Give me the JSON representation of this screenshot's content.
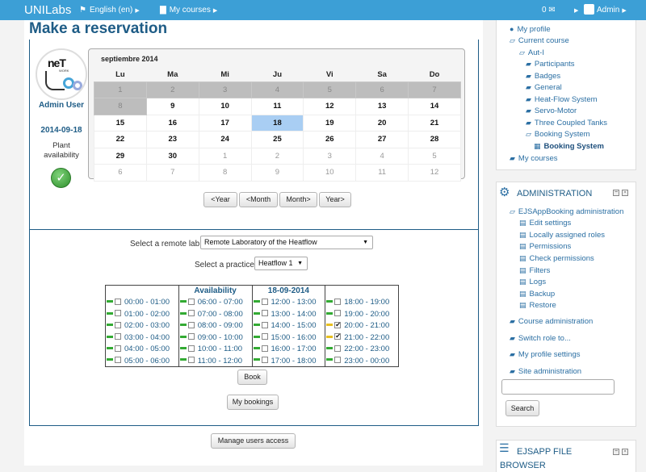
{
  "navbar": {
    "brand": "UNILabs",
    "language": "English (en)",
    "courses": "My courses",
    "messages": "0",
    "user": "Admin"
  },
  "page": {
    "title": "Make a reservation",
    "user_name": "Admin User",
    "date": "2014-09-18",
    "plant_availability": "Plant availability"
  },
  "calendar": {
    "month": "septiembre 2014",
    "weekdays": [
      "Lu",
      "Ma",
      "Mi",
      "Ju",
      "Vi",
      "Sa",
      "Do"
    ],
    "weeks": [
      [
        "1",
        "2",
        "3",
        "4",
        "5",
        "6",
        "7"
      ],
      [
        "8",
        "9",
        "10",
        "11",
        "12",
        "13",
        "14"
      ],
      [
        "15",
        "16",
        "17",
        "18",
        "19",
        "20",
        "21"
      ],
      [
        "22",
        "23",
        "24",
        "25",
        "26",
        "27",
        "28"
      ],
      [
        "29",
        "30",
        "1",
        "2",
        "3",
        "4",
        "5"
      ],
      [
        "6",
        "7",
        "8",
        "9",
        "10",
        "11",
        "12"
      ]
    ],
    "selected_day": "18",
    "buttons": [
      "<Year",
      "<Month",
      "Month>",
      "Year>"
    ]
  },
  "form": {
    "lab_label": "Select a remote lab",
    "lab_value": "Remote Laboratory of the Heatflow",
    "practice_label": "Select a practice",
    "practice_value": "Heatflow 1"
  },
  "slots": {
    "headers": [
      "",
      "Availability",
      "18-09-2014",
      ""
    ],
    "rows": [
      [
        {
          "t": "00:00 - 01:00",
          "s": "free",
          "c": false
        },
        {
          "t": "06:00 - 07:00",
          "s": "free",
          "c": false
        },
        {
          "t": "12:00 - 13:00",
          "s": "free",
          "c": false
        },
        {
          "t": "18:00 - 19:00",
          "s": "free",
          "c": false
        }
      ],
      [
        {
          "t": "01:00 - 02:00",
          "s": "free",
          "c": false
        },
        {
          "t": "07:00 - 08:00",
          "s": "free",
          "c": false
        },
        {
          "t": "13:00 - 14:00",
          "s": "free",
          "c": false
        },
        {
          "t": "19:00 - 20:00",
          "s": "free",
          "c": false
        }
      ],
      [
        {
          "t": "02:00 - 03:00",
          "s": "free",
          "c": false
        },
        {
          "t": "08:00 - 09:00",
          "s": "free",
          "c": false
        },
        {
          "t": "14:00 - 15:00",
          "s": "free",
          "c": false
        },
        {
          "t": "20:00 - 21:00",
          "s": "mine",
          "c": true
        }
      ],
      [
        {
          "t": "03:00 - 04:00",
          "s": "free",
          "c": false
        },
        {
          "t": "09:00 - 10:00",
          "s": "free",
          "c": false
        },
        {
          "t": "15:00 - 16:00",
          "s": "free",
          "c": false
        },
        {
          "t": "21:00 - 22:00",
          "s": "mine",
          "c": true
        }
      ],
      [
        {
          "t": "04:00 - 05:00",
          "s": "free",
          "c": false
        },
        {
          "t": "10:00 - 11:00",
          "s": "free",
          "c": false
        },
        {
          "t": "16:00 - 17:00",
          "s": "free",
          "c": false
        },
        {
          "t": "22:00 - 23:00",
          "s": "free",
          "c": false
        }
      ],
      [
        {
          "t": "05:00 - 06:00",
          "s": "free",
          "c": false
        },
        {
          "t": "11:00 - 12:00",
          "s": "free",
          "c": false
        },
        {
          "t": "17:00 - 18:00",
          "s": "free",
          "c": false
        },
        {
          "t": "23:00 - 00:00",
          "s": "free",
          "c": false
        }
      ]
    ],
    "status_colors": {
      "free": "#33aa33",
      "mine": "#e8c020"
    }
  },
  "actions": {
    "book": "Book",
    "my_bookings": "My bookings",
    "manage_users": "Manage users access"
  },
  "sidebar": {
    "nav": [
      {
        "label": "My profile",
        "icon": "person-icon"
      },
      {
        "label": "Current course",
        "icon": "folder-open-icon"
      },
      {
        "label": "Aut-I",
        "icon": "folder-open-icon"
      },
      {
        "label": "Participants",
        "icon": "folder-icon"
      },
      {
        "label": "Badges",
        "icon": "folder-icon"
      },
      {
        "label": "General",
        "icon": "folder-icon"
      },
      {
        "label": "Heat-Flow System",
        "icon": "folder-icon"
      },
      {
        "label": "Servo-Motor",
        "icon": "folder-icon"
      },
      {
        "label": "Three Coupled Tanks",
        "icon": "folder-icon"
      },
      {
        "label": "Booking System",
        "icon": "folder-open-icon"
      },
      {
        "label": "Booking System",
        "icon": "calendar-icon"
      },
      {
        "label": "My courses",
        "icon": "folder-icon"
      }
    ],
    "admin": {
      "title": "ADMINISTRATION",
      "items": [
        {
          "label": "EJSAppBooking administration",
          "icon": "folder-open-icon"
        },
        {
          "label": "Edit settings",
          "icon": "document-icon"
        },
        {
          "label": "Locally assigned roles",
          "icon": "document-icon"
        },
        {
          "label": "Permissions",
          "icon": "document-icon"
        },
        {
          "label": "Check permissions",
          "icon": "document-icon"
        },
        {
          "label": "Filters",
          "icon": "document-icon"
        },
        {
          "label": "Logs",
          "icon": "document-icon"
        },
        {
          "label": "Backup",
          "icon": "document-icon"
        },
        {
          "label": "Restore",
          "icon": "document-icon"
        },
        {
          "label": "Course administration",
          "icon": "folder-icon"
        },
        {
          "label": "Switch role to...",
          "icon": "folder-icon"
        },
        {
          "label": "My profile settings",
          "icon": "folder-icon"
        },
        {
          "label": "Site administration",
          "icon": "folder-icon"
        }
      ],
      "search_button": "Search"
    },
    "file_block": {
      "title_line1": "EJSAPP FILE",
      "title_line2": "BROWSER"
    }
  }
}
